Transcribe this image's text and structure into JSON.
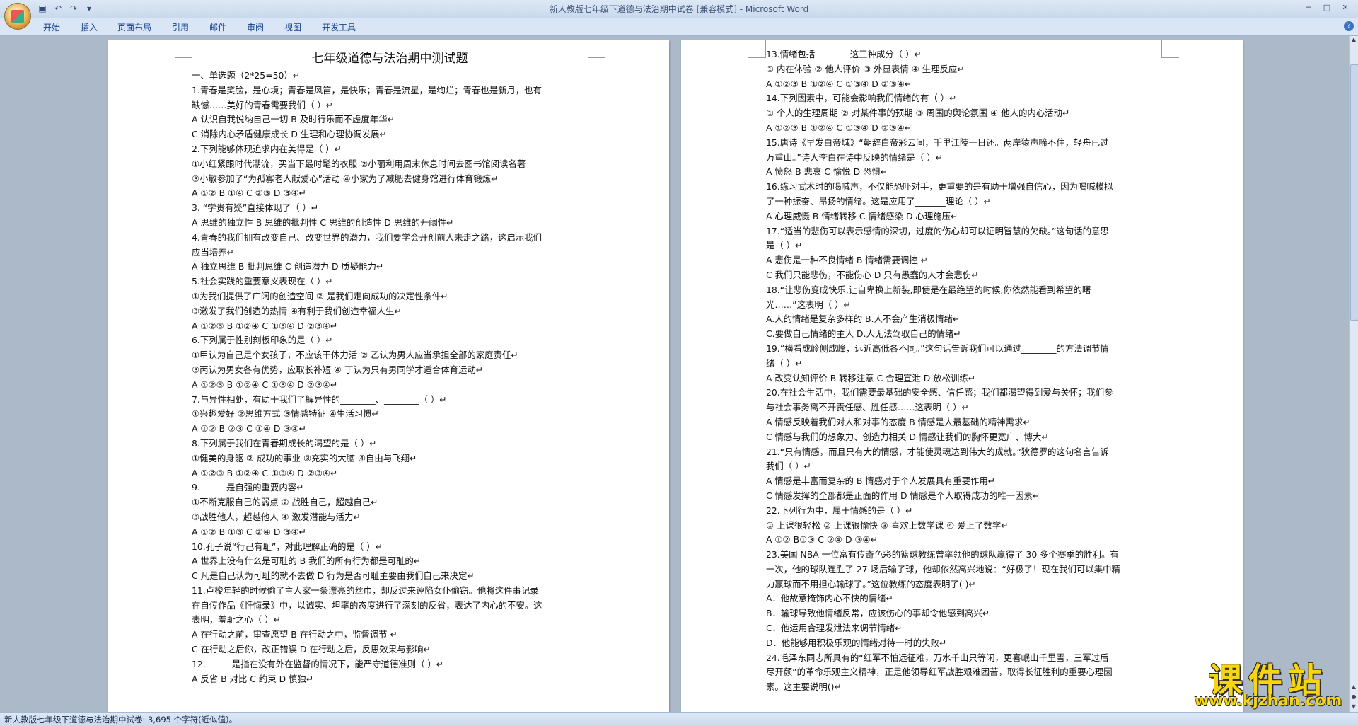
{
  "window": {
    "title": "新人教版七年级下道德与法治期中试卷 [兼容模式] - Microsoft Word"
  },
  "ribbon": {
    "tabs": [
      "开始",
      "插入",
      "页面布局",
      "引用",
      "邮件",
      "审阅",
      "视图",
      "开发工具"
    ]
  },
  "document": {
    "title": "七年级道德与法治期中测试题",
    "left_page_lines": [
      "一、单选题（2*25=50）↵",
      "1.青春是笑脸，是心境；青春是风笛，是快乐；青春是流星，是绚烂；青春也是新月，也有",
      "缺憾……美好的青春需要我们（     ）↵",
      "A 认识自我悦纳自己一切         B  及时行乐而不虚度年华↵",
      "C 消除内心矛盾健康成长         D  生理和心理协调发展↵",
      "2.下列能够体现追求内在美得是（      ）↵",
      "①小红紧跟时代潮流，买当下最时髦的衣服     ②小丽利用周末休息时间去图书馆阅读名著",
      "③小敏参加了“为孤寡老人献爱心”活动       ④小家为了减肥去健身馆进行体育锻炼↵",
      "A ①②         B ①④           C  ②③          D  ③④↵",
      "3. “学贵有疑”直接体现了（       ）↵",
      "A 思维的独立性        B  思维的批判性         C  思维的创造性          D  思维的开阔性↵",
      "4.青春的我们拥有改变自己、改变世界的潜力，我们要学会开创前人未走之路，这启示我们",
      "应当培养↵",
      "A 独立思维     B  批判思维     C  创造潜力       D  质疑能力↵",
      "5.社会实践的重要意义表现在（      ）↵",
      "①为我们提供了广阔的创造空间      ②  是我们走向成功的决定性条件↵",
      "③激发了我们创造的热情            ④有利于我们创造幸福人生↵",
      "A ①②③         B  ①②④          C  ①③④          D  ②③④↵",
      "6.下列属于性别刻板印象的是（       ）↵",
      "①甲认为自己是个女孩子，不应该干体力活    ②  乙认为男人应当承担全部的家庭责任↵",
      "③丙认为男女各有优势，应取长补短          ④  丁认为只有男同学才适合体育运动↵",
      "A ①②③         B  ①②④          C  ①③④          D  ②③④↵",
      "7.与异性相处，有助于我们了解异性的________、________（       ）↵",
      "①兴趣爱好     ②思维方式        ③情感特征        ④生活习惯↵",
      "A ①②          B ②③           C  ①④           D  ③④↵",
      "8.下列属于我们在青春期成长的渴望的是（       ）↵",
      "①健美的身躯         ②  成功的事业      ③充实的大脑          ④自由与飞翔↵",
      "A ①②③         B  ①②④          C  ①③④          D  ②③④↵",
      "9.______是自强的重要内容↵",
      "①不断克服自己的弱点             ②  战胜自己，超越自己↵",
      "③战胜他人，超越他人             ④  激发潜能与活力↵",
      "A ①②          B ①③          C  ②④          D  ③④↵",
      "10.孔子说“行己有耻”，对此理解正确的是（       ）↵",
      "A 世界上没有什么是可耻的                 B  我们的所有行为都是可耻的↵",
      "C 凡是自己认为可耻的就不去做             D  行为是否可耻主要由我们自己来决定↵",
      "11.卢梭年轻的时候偷了主人家一条漂亮的丝巾，却反过来诬陷女仆偷窃。他将这件事记录",
      "在自传作品《忏悔录》中，以诚实、坦率的态度进行了深刻的反省，表达了内心的不安。这",
      "表明，羞耻之心（       ）↵",
      "A 在行动之前，审查愿望             B  在行动之中，监督调节   ↵",
      "C 在行动之后你，改正错误           D  在行动之后，反思效果与影响↵",
      "12.______是指在没有外在监督的情况下，能严守道德准则（        ）↵",
      "A 反省          B  对比           C  约束           D  慎独↵"
    ],
    "right_page_lines": [
      "13.情绪包括________这三钟成分（        ）↵",
      "①  内在体验     ②  他人评价       ③  外显表情             ④  生理反应↵",
      "A ①②③          B  ①②④          C  ①③④          D  ②③④↵",
      "14.下列因素中，可能会影响我们情绪的有（       ）↵",
      "①  个人的生理周期     ②  对某件事的预期        ③  周围的舆论氛围          ④  他人的内心活动↵",
      "A ①②③          B  ①②④          C  ①③④          D  ②③④↵",
      "15.唐诗《早发白帝城》“朝辞白帝彩云间，千里江陵一日还。两岸猿声啼不住，轻舟已过",
      "万重山。”诗人李白在诗中反映的情绪是（       ）↵",
      "A  愤怒        B  悲哀       C  愉悦        D  恐惧↵",
      "16.练习武术时的喝喊声，不仅能恐吓对手，更重要的是有助于增强自信心，因为喝喊模拟",
      "了一种振奋、昂扬的情绪。这是应用了_______理论（     ）↵",
      "A 心理威慑          B  情绪转移         C  情绪感染          D  心理施压↵",
      "17.“适当的悲伤可以表示感情的深切，过度的伤心却可以证明智慧的欠缺。”这句话的意思",
      "是（        ）↵",
      "A 悲伤是一种不良情绪                         B  情绪需要调控     ↵",
      "C 我们只能悲伤，不能伤心                     D  只有愚蠢的人才会悲伤↵",
      "18.“让悲伤变成快乐,让自卑换上新装,即使是在最绝望的时候,你依然能看到希望的曙",
      "光……”这表明（         ）↵",
      "A.人的情绪是复杂多样的                                 B.人不会产生消极情绪↵",
      "C.要做自己情绪的主人                                   D.人无法驾驭自己的情绪↵",
      "19.“横看成岭侧成峰，远近高低各不同。”这句话告诉我们可以通过________的方法调节情",
      "绪（        ）↵",
      "A 改变认知评价           B  转移注意          C  合理宣泄          D  放松训练↵",
      "20.在社会生活中，我们需要最基础的安全感、信任感；我们都渴望得到爱与关怀；我们参",
      "与社会事务离不开责任感、胜任感……这表明（       ）↵",
      "A 情感反映着我们对人和对事的态度                 B  情感是人最基础的精神需求↵",
      "C 情感与我们的想象力、创造力相关                 D  情感让我们的胸怀更宽广、博大↵",
      "21.“只有情感，而且只有大的情感，才能使灵魂达到伟大的成就。”狄德罗的这句名言告诉",
      "我们（        ）↵",
      "A 情感是丰富而复杂的                         B  情感对于个人发展具有重要作用↵",
      "C 情感发挥的全部都是正面的作用               D  情感是个人取得成功的唯一因素↵",
      "22.下列行为中，属于情感的是（        ）↵",
      "①  上课很轻松         ②  上课很愉快        ③  喜欢上数学课        ④  爱上了数学↵",
      "A ①②          B①③           C  ②④          D  ③④↵",
      "23.美国 NBA 一位富有传奇色彩的篮球教练曾率领他的球队赢得了 30 多个赛季的胜利。有",
      "一次，他的球队连胜了 27 场后输了球，他却依然高兴地说：“好极了！现在我们可以集中精",
      "力赢球而不用担心输球了。”这位教练的态度表明了(         )↵",
      "A．他故意掩饰内心不快的情绪↵",
      "B．输球导致他情绪反常，应该伤心的事却令他感到高兴↵",
      "C．他运用合理发泄法来调节情绪↵",
      "D．他能够用积极乐观的情绪对待一时的失败↵",
      "24.毛泽东同志所具有的“红军不怕远征难，万水千山只等闲，更喜岷山千里雪，三军过后",
      "尽开颜”的革命乐观主义精神，正是他领导红军战胜艰难困苦，取得长征胜利的重要心理因",
      "素。这主要说明()↵"
    ]
  },
  "status_bar": {
    "text": "新人教版七年级下道德与法治期中试卷: 3,695 个字符(近似值)。"
  },
  "watermark": {
    "main": "课件站",
    "url": "www.kjzhan.com"
  },
  "icons": {
    "office_button": "office-logo-icon",
    "save": "save-icon",
    "undo": "undo-icon",
    "redo": "redo-icon",
    "help": "help-icon"
  }
}
